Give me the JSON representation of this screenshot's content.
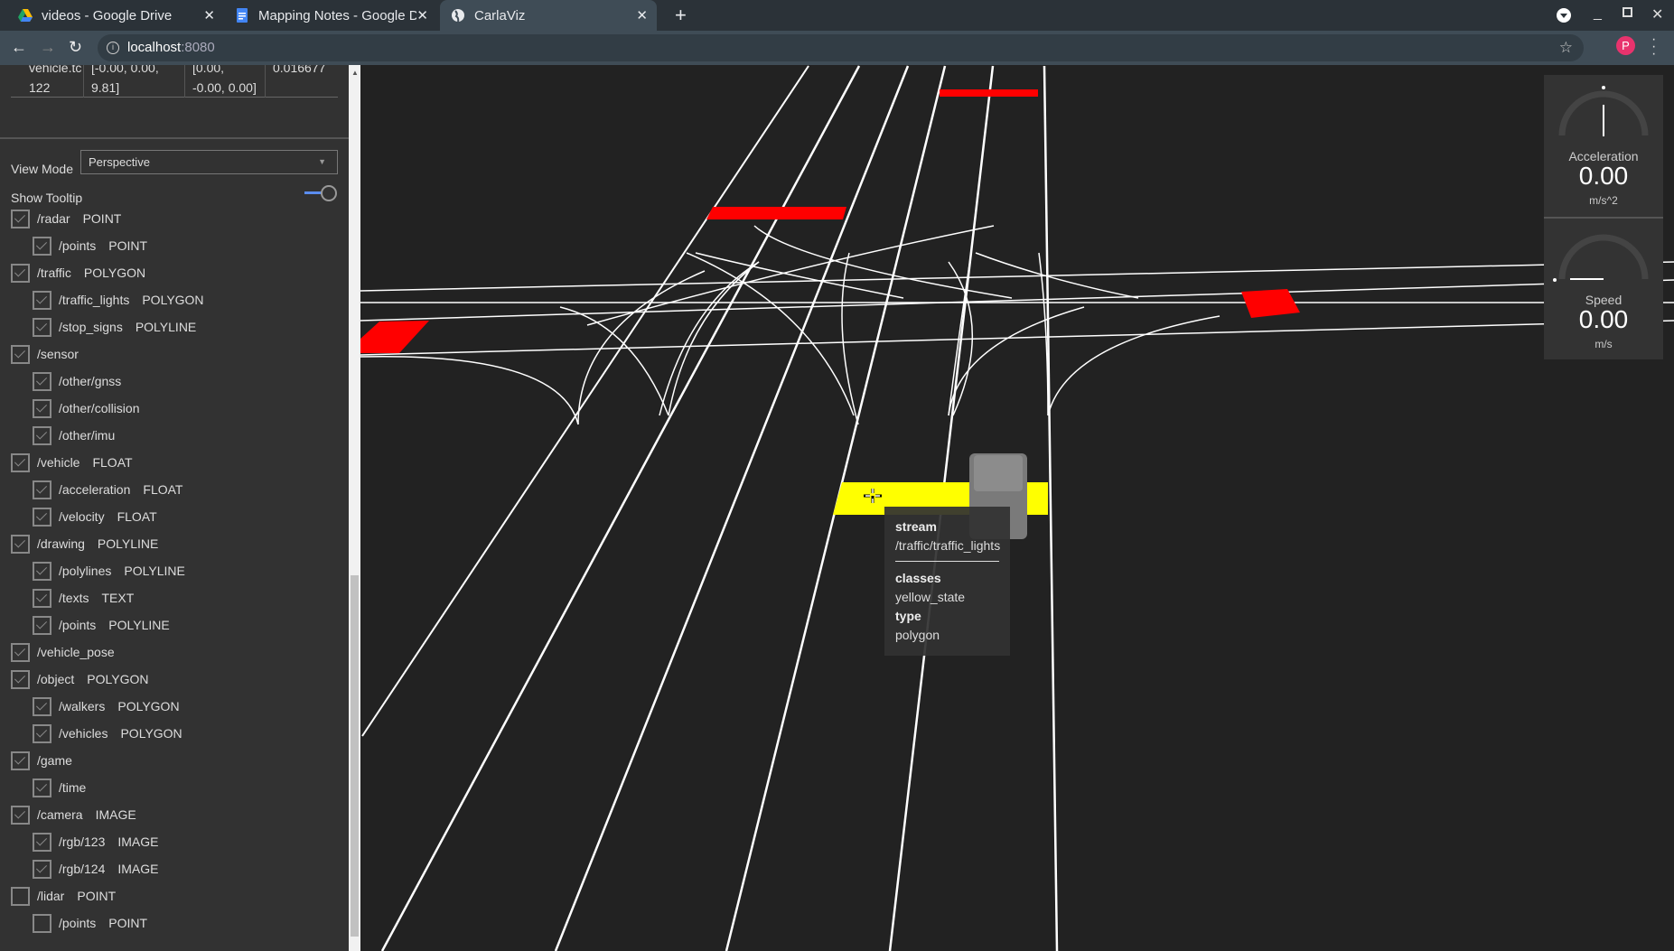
{
  "browser": {
    "tabs": [
      {
        "title": "videos - Google Drive",
        "icon": "google-drive-icon"
      },
      {
        "title": "Mapping Notes - Google D",
        "icon": "google-docs-icon"
      },
      {
        "title": "CarlaViz",
        "icon": "globe-icon",
        "active": true
      }
    ],
    "url_host": "localhost",
    "url_port": ":8080",
    "profile_initial": "P"
  },
  "sidebar": {
    "table_row": [
      "vehicle.tc\n122",
      "[-0.00, 0.00,\n9.81]",
      "[0.00,\n-0.00, 0.00]",
      "0.016677"
    ],
    "view_mode_label": "View Mode",
    "view_mode_value": "Perspective",
    "show_tooltip_label": "Show Tooltip",
    "show_tooltip_on": true,
    "streams": [
      {
        "name": "/radar",
        "type": "POINT",
        "level": 0,
        "checked": true
      },
      {
        "name": "/points",
        "type": "POINT",
        "level": 1,
        "checked": true
      },
      {
        "name": "/traffic",
        "type": "POLYGON",
        "level": 0,
        "checked": true
      },
      {
        "name": "/traffic_lights",
        "type": "POLYGON",
        "level": 1,
        "checked": true
      },
      {
        "name": "/stop_signs",
        "type": "POLYLINE",
        "level": 1,
        "checked": true
      },
      {
        "name": "/sensor",
        "type": "",
        "level": 0,
        "checked": true
      },
      {
        "name": "/other/gnss",
        "type": "",
        "level": 1,
        "checked": true
      },
      {
        "name": "/other/collision",
        "type": "",
        "level": 1,
        "checked": true
      },
      {
        "name": "/other/imu",
        "type": "",
        "level": 1,
        "checked": true
      },
      {
        "name": "/vehicle",
        "type": "FLOAT",
        "level": 0,
        "checked": true
      },
      {
        "name": "/acceleration",
        "type": "FLOAT",
        "level": 1,
        "checked": true
      },
      {
        "name": "/velocity",
        "type": "FLOAT",
        "level": 1,
        "checked": true
      },
      {
        "name": "/drawing",
        "type": "POLYLINE",
        "level": 0,
        "checked": true
      },
      {
        "name": "/polylines",
        "type": "POLYLINE",
        "level": 1,
        "checked": true
      },
      {
        "name": "/texts",
        "type": "TEXT",
        "level": 1,
        "checked": true
      },
      {
        "name": "/points",
        "type": "POLYLINE",
        "level": 1,
        "checked": true
      },
      {
        "name": "/vehicle_pose",
        "type": "",
        "level": 0,
        "checked": true
      },
      {
        "name": "/object",
        "type": "POLYGON",
        "level": 0,
        "checked": true
      },
      {
        "name": "/walkers",
        "type": "POLYGON",
        "level": 1,
        "checked": true
      },
      {
        "name": "/vehicles",
        "type": "POLYGON",
        "level": 1,
        "checked": true
      },
      {
        "name": "/game",
        "type": "",
        "level": 0,
        "checked": true
      },
      {
        "name": "/time",
        "type": "",
        "level": 1,
        "checked": true
      },
      {
        "name": "/camera",
        "type": "IMAGE",
        "level": 0,
        "checked": true
      },
      {
        "name": "/rgb/123",
        "type": "IMAGE",
        "level": 1,
        "checked": true
      },
      {
        "name": "/rgb/124",
        "type": "IMAGE",
        "level": 1,
        "checked": true
      },
      {
        "name": "/lidar",
        "type": "POINT",
        "level": 0,
        "checked": false
      },
      {
        "name": "/points",
        "type": "POINT",
        "level": 1,
        "checked": false
      }
    ]
  },
  "gauges": [
    {
      "label": "Acceleration",
      "value": "0.00",
      "unit": "m/s^2"
    },
    {
      "label": "Speed",
      "value": "0.00",
      "unit": "m/s"
    }
  ],
  "tooltip": {
    "stream_label": "stream",
    "stream": "/traffic/traffic_lights",
    "classes_label": "classes",
    "classes": "yellow_state",
    "type_label": "type",
    "type": "polygon"
  },
  "colors": {
    "traffic_red": "#ff0000",
    "traffic_yellow": "#ffff00",
    "lane": "#ffffff",
    "accent": "#5b8def",
    "profile": "#e8336d"
  }
}
